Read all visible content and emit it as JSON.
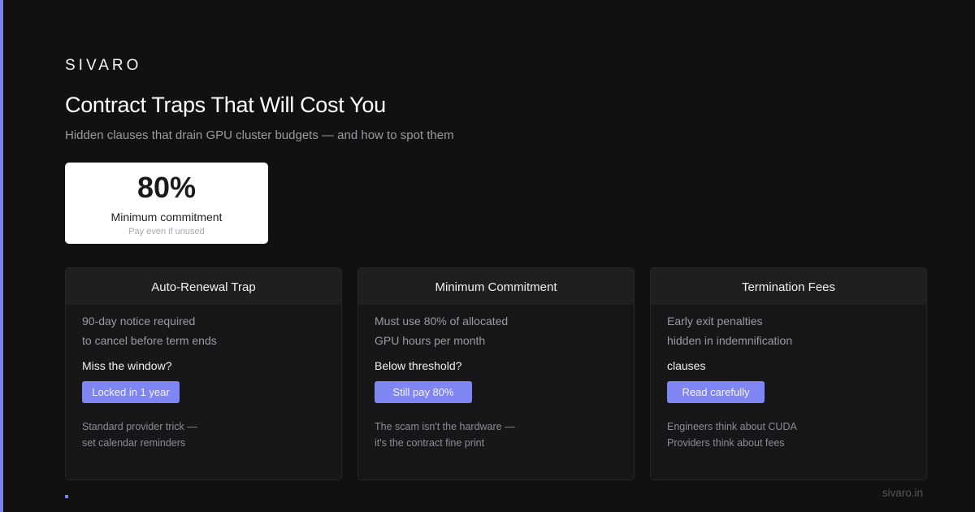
{
  "brand": "SIVARO",
  "title": "Contract Traps That Will Cost You",
  "subtitle": "Hidden clauses that drain GPU cluster budgets — and how to spot them",
  "stat": {
    "value": "80%",
    "label": "Minimum commitment",
    "note": "Pay even if unused"
  },
  "cards": [
    {
      "title": "Auto-Renewal Trap",
      "line1": "90-day notice required",
      "line2": "to cancel before term ends",
      "question": "Miss the window?",
      "button": "Locked in 1 year",
      "foot1": "Standard provider trick —",
      "foot2": "set calendar reminders"
    },
    {
      "title": "Minimum Commitment",
      "line1": "Must use 80% of allocated",
      "line2": "GPU hours per month",
      "question": "Below threshold?",
      "button": "Still pay 80%",
      "foot1": "The scam isn't the hardware —",
      "foot2": "it's the contract fine print"
    },
    {
      "title": "Termination Fees",
      "line1": "Early exit penalties",
      "line2": "hidden in indemnification",
      "question": "clauses",
      "button": "Read carefully",
      "foot1": "Engineers think about CUDA",
      "foot2": "Providers think about fees"
    }
  ],
  "footer": {
    "url": "sivaro.in"
  },
  "colors": {
    "background": "#111112",
    "accent": "#7c82f0",
    "card": "#171719",
    "card_header": "#1f1f22",
    "button": "#7f85f2"
  }
}
